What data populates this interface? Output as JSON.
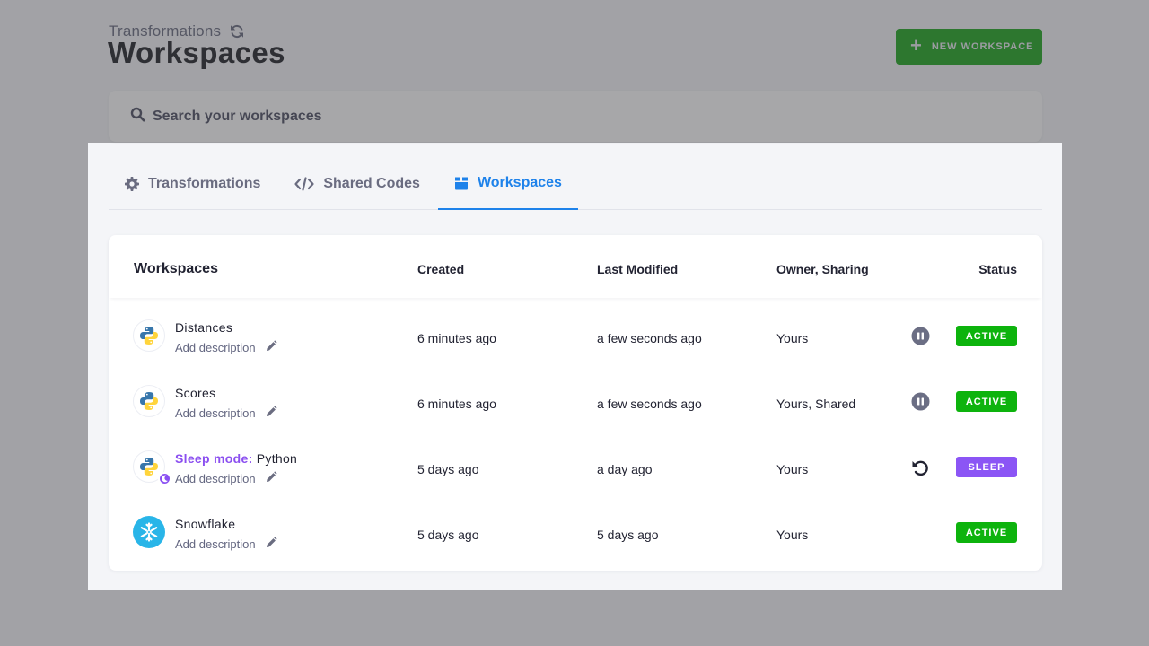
{
  "header": {
    "breadcrumb": "Transformations",
    "title": "Workspaces",
    "new_button_label": "NEW WORKSPACE"
  },
  "search": {
    "placeholder": "Search your workspaces",
    "value": ""
  },
  "tabs": [
    {
      "label": "Transformations",
      "icon": "gear-icon",
      "active": false
    },
    {
      "label": "Shared Codes",
      "icon": "code-icon",
      "active": false
    },
    {
      "label": "Workspaces",
      "icon": "box-icon",
      "active": true
    }
  ],
  "table": {
    "columns": [
      "Workspaces",
      "Created",
      "Last Modified",
      "Owner, Sharing",
      "Status"
    ],
    "rows": [
      {
        "name": "Distances",
        "prefix": "",
        "description": "Add description",
        "created": "6 minutes ago",
        "modified": "a few seconds ago",
        "owner": "Yours",
        "action": "pause-icon",
        "status": "ACTIVE",
        "icon": "python-icon"
      },
      {
        "name": "Scores",
        "prefix": "",
        "description": "Add description",
        "created": "6 minutes ago",
        "modified": "a few seconds ago",
        "owner": "Yours, Shared",
        "action": "pause-icon",
        "status": "ACTIVE",
        "icon": "python-icon"
      },
      {
        "name": "Python",
        "prefix": "Sleep mode:",
        "description": "Add description",
        "created": "5 days ago",
        "modified": "a day ago",
        "owner": "Yours",
        "action": "resume-icon",
        "status": "SLEEP",
        "icon": "python-icon"
      },
      {
        "name": "Snowflake",
        "prefix": "",
        "description": "Add description",
        "created": "5 days ago",
        "modified": "5 days ago",
        "owner": "Yours",
        "action": "",
        "status": "ACTIVE",
        "icon": "snowflake-icon"
      }
    ]
  },
  "colors": {
    "accent_blue": "#1e82ea",
    "active_green": "#0db30d",
    "sleep_purple": "#8b55f5",
    "primary_button": "#0b9f0b"
  }
}
